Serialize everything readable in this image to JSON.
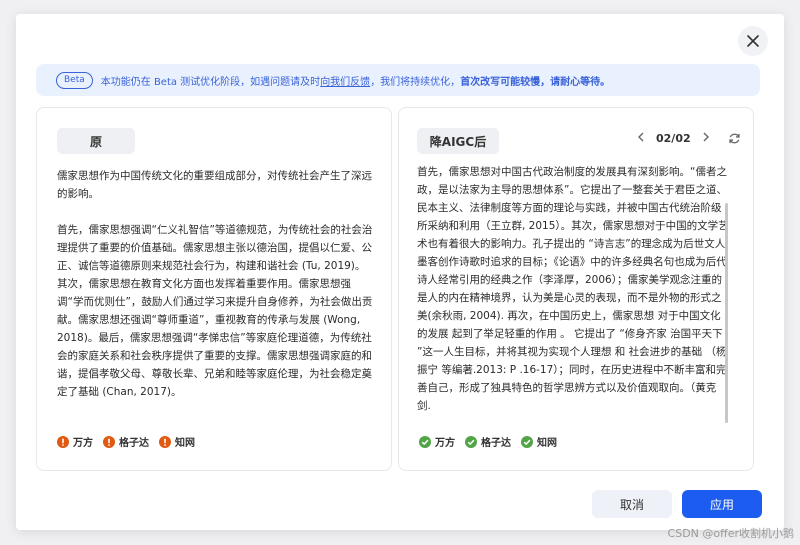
{
  "banner": {
    "badge": "Beta",
    "text_before": "本功能仍在 Beta 测试优化阶段，如遇问题请及时",
    "link": "向我们反馈",
    "text_middle": "，我们将持续优化，",
    "text_strong": "首次改写可能较慢，请耐心等待。"
  },
  "left_panel": {
    "title": "原",
    "paragraphs": [
      "儒家思想作为中国传统文化的重要组成部分，对传统社会产生了深远的影响。",
      "首先，儒家思想强调“仁义礼智信”等道德规范，为传统社会的社会治理提供了重要的价值基础。儒家思想主张以德治国，提倡以仁爱、公正、诚信等道德原则来规范社会行为，构建和谐社会 (Tu, 2019)。其次，儒家思想在教育文化方面也发挥着重要作用。儒家思想强调“学而优则仕”，鼓励人们通过学习来提升自身修养，为社会做出贡献。儒家思想还强调“尊师重道”，重视教育的传承与发展 (Wong, 2018)。最后，儒家思想强调“孝悌忠信”等家庭伦理道德，为传统社会的家庭关系和社会秩序提供了重要的支撑。儒家思想强调家庭的和谐，提倡孝敬父母、尊敬长辈、兄弟和睦等家庭伦理，为社会稳定奠定了基础 (Chan, 2017)。"
    ],
    "sources": [
      "万方",
      "格子达",
      "知网"
    ]
  },
  "right_panel": {
    "title": "降AIGC后",
    "pager": "02/02",
    "text": "首先，儒家思想对中国古代政治制度的发展具有深刻影响。“儒者之政，是以法家为主导的思想体系”。它提出了一整套关于君臣之道、民本主义、法律制度等方面的理论与实践，并被中国古代统治阶级所采纳和利用（王立群, 2015）。其次，儒家思想对于中国的文学艺术也有着很大的影响力。孔子提出的 “诗言志”的理念成为后世文人墨客创作诗歌时追求的目标；《论语》中的许多经典名句也成为后代诗人经常引用的经典之作（李泽厚，2006）；儒家美学观念注重的是人的内在精神境界，认为美是心灵的表现，而不是外物的形式之美(余秋雨, 2004). 再次，在中国历史上，儒家思想 对于中国文化 的发展 起到了举足轻重的作用 。 它提出了 “修身齐家 治国平天下 ”这一人生目标，并将其视为实现个人理想 和 社会进步的基础 （杨振宁 等编著.2013: P .16-17）；同时，在历史进程中不断丰富和完善自己，形成了独具特色的哲学思辨方式以及价值观取向。（黄克剑.",
    "sources": [
      "万方",
      "格子达",
      "知网"
    ]
  },
  "buttons": {
    "cancel": "取消",
    "apply": "应用"
  },
  "watermark": "CSDN @offer收割机小鹅",
  "colors": {
    "accent": "#1d5cf0",
    "warning": "#e05a12",
    "success": "#52a447"
  }
}
